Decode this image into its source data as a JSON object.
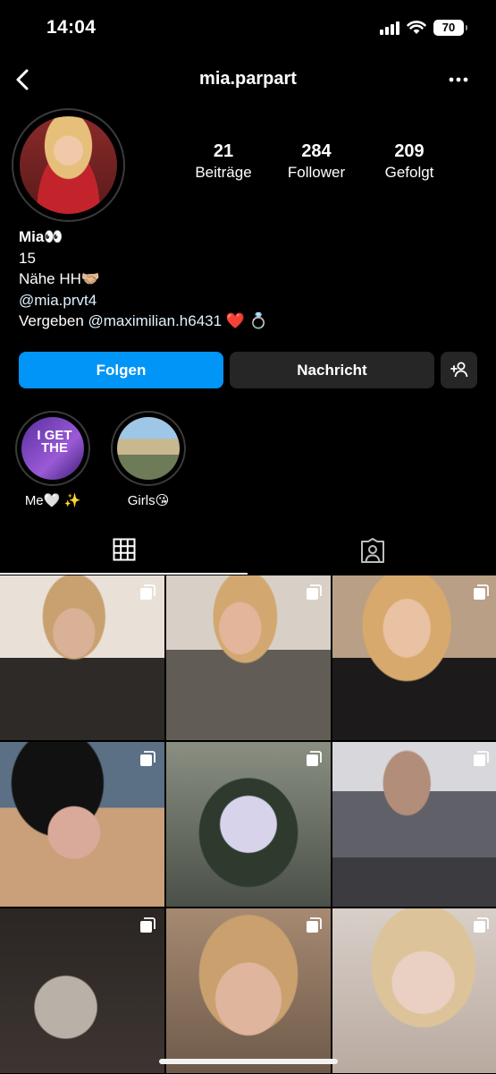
{
  "status_bar": {
    "time": "14:04",
    "battery": "70"
  },
  "header": {
    "username": "mia.parpart"
  },
  "stats": [
    {
      "value": "21",
      "label": "Beiträge"
    },
    {
      "value": "284",
      "label": "Follower"
    },
    {
      "value": "209",
      "label": "Gefolgt"
    }
  ],
  "bio": {
    "name": "Mia👀",
    "line1": "15",
    "line2": "Nähe HH🤝🏼",
    "line3": "@mia.prvt4",
    "line4_text": "Vergeben ",
    "line4_mention": "@maximilian.h6431",
    "line4_emoji": " ❤️ 💍"
  },
  "actions": {
    "follow": "Folgen",
    "message": "Nachricht"
  },
  "highlights": [
    {
      "label": "Me🤍 ✨",
      "cover_text": "I GET THE"
    },
    {
      "label": "Girls😘"
    }
  ],
  "tabs": [
    "posts",
    "tagged"
  ]
}
